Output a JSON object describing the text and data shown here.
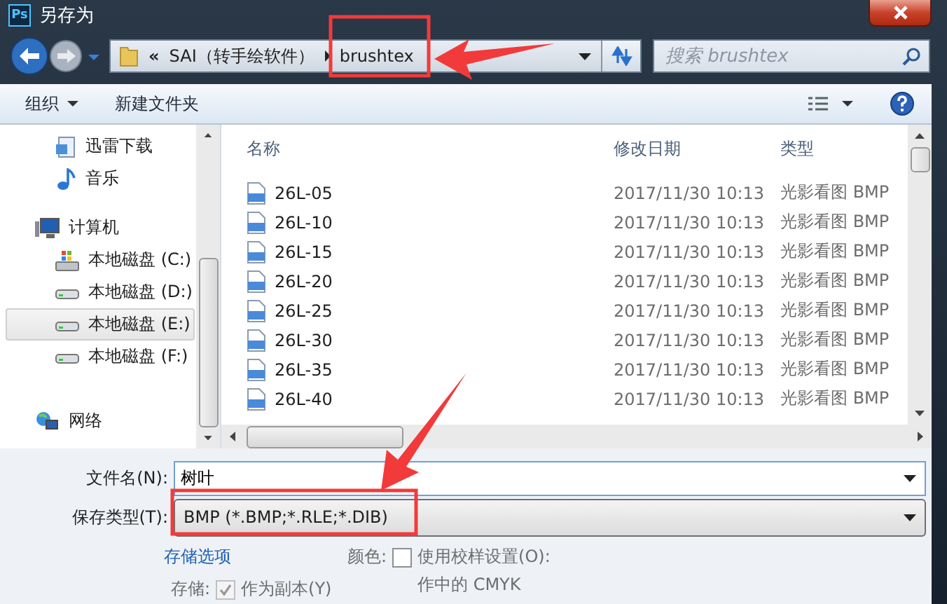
{
  "window": {
    "title": "另存为",
    "app_icon_text": "Ps"
  },
  "nav": {
    "breadcrumb": [
      "«",
      "SAI（转手绘软件）",
      "brushtex"
    ],
    "search": {
      "placeholder": "搜索 brushtex"
    }
  },
  "toolbar": {
    "organize": "组织",
    "new_folder": "新建文件夹"
  },
  "sidebar": {
    "items": [
      {
        "label": "迅雷下载",
        "kind": "download",
        "selected": false
      },
      {
        "label": "音乐",
        "kind": "music",
        "selected": false
      },
      {
        "label": "计算机",
        "kind": "computer",
        "selected": false
      },
      {
        "label": "本地磁盘 (C:)",
        "kind": "system-drive",
        "selected": false
      },
      {
        "label": "本地磁盘 (D:)",
        "kind": "drive",
        "selected": false
      },
      {
        "label": "本地磁盘 (E:)",
        "kind": "drive",
        "selected": true
      },
      {
        "label": "本地磁盘 (F:)",
        "kind": "drive",
        "selected": false
      },
      {
        "label": "网络",
        "kind": "network",
        "selected": false
      }
    ]
  },
  "file_list": {
    "columns": [
      "名称",
      "修改日期",
      "类型"
    ],
    "rows": [
      {
        "name": "26L-05",
        "date": "2017/11/30 10:13",
        "type": "光影看图 BMP"
      },
      {
        "name": "26L-10",
        "date": "2017/11/30 10:13",
        "type": "光影看图 BMP"
      },
      {
        "name": "26L-15",
        "date": "2017/11/30 10:13",
        "type": "光影看图 BMP"
      },
      {
        "name": "26L-20",
        "date": "2017/11/30 10:13",
        "type": "光影看图 BMP"
      },
      {
        "name": "26L-25",
        "date": "2017/11/30 10:13",
        "type": "光影看图 BMP"
      },
      {
        "name": "26L-30",
        "date": "2017/11/30 10:13",
        "type": "光影看图 BMP"
      },
      {
        "name": "26L-35",
        "date": "2017/11/30 10:13",
        "type": "光影看图 BMP"
      },
      {
        "name": "26L-40",
        "date": "2017/11/30 10:13",
        "type": "光影看图 BMP"
      }
    ]
  },
  "form": {
    "filename_label": "文件名(N):",
    "filename": "树叶",
    "type_label": "保存类型(T):",
    "type": "BMP (*.BMP;*.RLE;*.DIB)",
    "options_link": "存储选项",
    "save_label": "存储:",
    "as_copy": {
      "label": "作为副本(Y)",
      "checked": true,
      "disabled": true
    },
    "color_label": "颜色:",
    "proof": {
      "label": "使用校样设置(O):",
      "checked": false
    },
    "proof_value": "作中的 CMYK"
  }
}
